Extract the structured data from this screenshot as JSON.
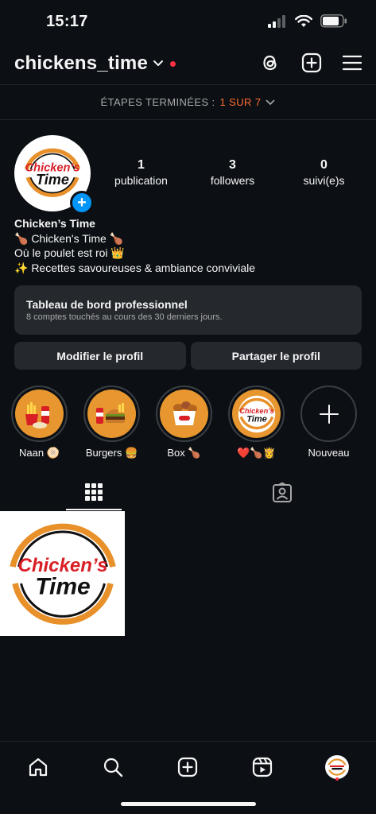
{
  "status_bar": {
    "time": "15:17"
  },
  "header": {
    "username": "chickens_time"
  },
  "steps": {
    "label": "ÉTAPES TERMINÉES :",
    "value": "1 SUR 7"
  },
  "profile": {
    "stats": [
      {
        "num": "1",
        "label": "publication"
      },
      {
        "num": "3",
        "label": "followers"
      },
      {
        "num": "0",
        "label": "suivi(e)s"
      }
    ],
    "name": "Chicken’s Time",
    "bio_lines": [
      "🍗 Chicken's Time 🍗",
      "Où le poulet est roi 👑",
      "✨ Recettes savoureuses & ambiance conviviale"
    ],
    "logo_text": {
      "line1": "Chicken’s",
      "line2": "Time"
    }
  },
  "dashboard": {
    "title": "Tableau de bord professionnel",
    "subtitle": "8 comptes touchés au cours des 30 derniers jours."
  },
  "buttons": {
    "edit": "Modifier le profil",
    "share": "Partager le profil"
  },
  "highlights": [
    {
      "label": "Naan 🫓"
    },
    {
      "label": "Burgers 🍔"
    },
    {
      "label": "Box 🍗"
    },
    {
      "label": "❤️🍗👸"
    },
    {
      "label": "Nouveau"
    }
  ],
  "colors": {
    "background": "#0c1014",
    "accent": "#ff6b2c",
    "link_blue": "#0095f6",
    "notification": "#ff3040",
    "card": "#25292e"
  }
}
